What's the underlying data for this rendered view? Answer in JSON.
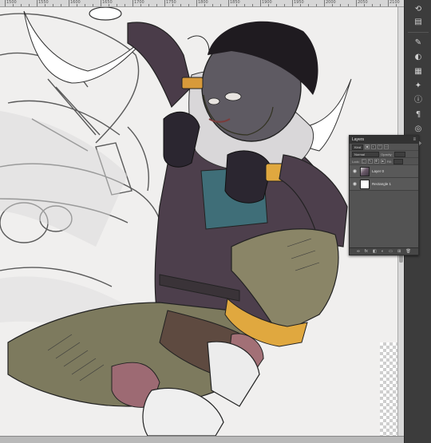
{
  "ruler": {
    "labels": [
      "1500",
      "1550",
      "1600",
      "1650",
      "1700",
      "1750",
      "1800",
      "1850",
      "1900",
      "1950",
      "2000",
      "2050",
      "2100"
    ]
  },
  "layers_panel": {
    "title": "Layers",
    "kind_filter": "Kind",
    "blend_mode": "Normal",
    "opacity_label": "Opacity:",
    "lock_label": "Lock:",
    "fill_label": "Fill:",
    "layers": [
      {
        "name": "Layer 0",
        "thumb": "art",
        "visible": true
      },
      {
        "name": "Rectangle 1",
        "thumb": "white",
        "visible": true
      }
    ]
  },
  "icons": {
    "eye": "eye-icon",
    "panel_menu": "panel-menu-icon"
  }
}
